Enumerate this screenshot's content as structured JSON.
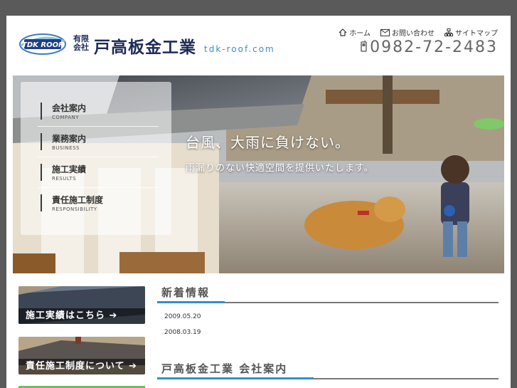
{
  "header": {
    "logo_text": "TDK ROOF",
    "company_kind": "有限会社",
    "company_name": "戸高板金工業",
    "domain": "tdk-roof.com",
    "phone": "0982-72-2483",
    "nav": [
      {
        "label": "ホーム",
        "icon": "home-icon"
      },
      {
        "label": "お問い合わせ",
        "icon": "mail-icon"
      },
      {
        "label": "サイトマップ",
        "icon": "sitemap-icon"
      }
    ]
  },
  "hero": {
    "slogan_main": "台風、大雨に負けない。",
    "slogan_sub": "雨漏りのない快適空間を提供いたします。"
  },
  "menu": [
    {
      "jp": "会社案内",
      "en": "COMPANY"
    },
    {
      "jp": "業務案内",
      "en": "BUSINESS"
    },
    {
      "jp": "施工実績",
      "en": "RESULTS"
    },
    {
      "jp": "責任施工制度",
      "en": "RESPONSIBILITY"
    }
  ],
  "banners": [
    {
      "label": "施工実績はこちら ➔"
    },
    {
      "label": "責任施工制度について ➔"
    }
  ],
  "news": {
    "title": "新着情報",
    "dates": [
      "2009.05.20",
      "2008.03.19"
    ]
  },
  "company_section": {
    "title": "戸高板金工業 会社案内"
  },
  "colors": {
    "accent": "#2f8fd0",
    "brand_navy": "#1d2b57",
    "background": "#5a5a5a"
  }
}
